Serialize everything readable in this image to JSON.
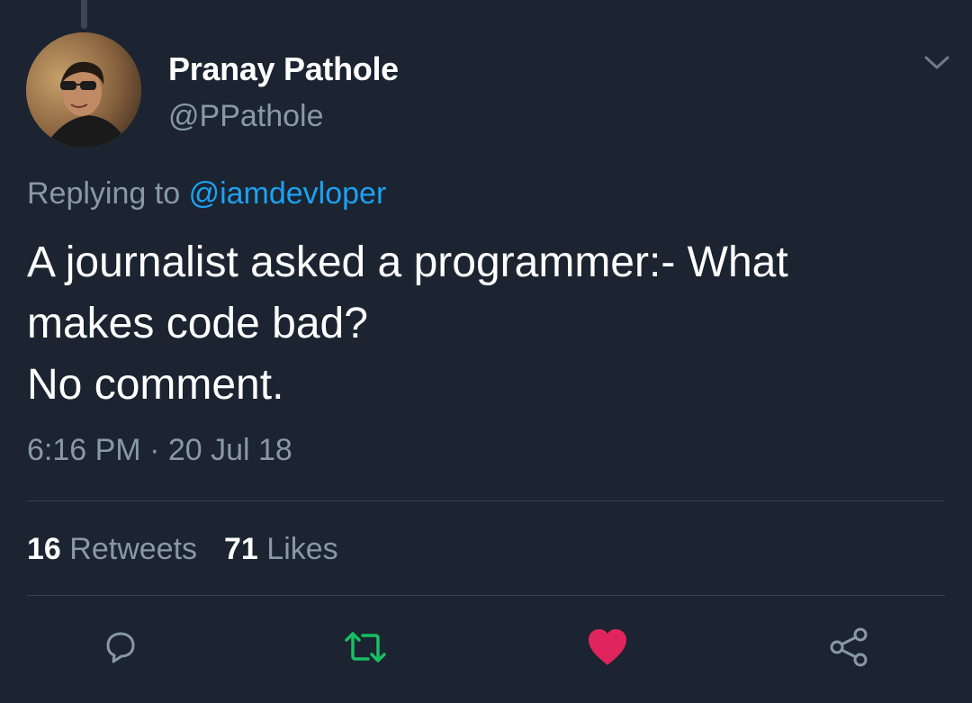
{
  "author": {
    "display_name": "Pranay Pathole",
    "handle": "@PPathole"
  },
  "reply": {
    "prefix": "Replying to",
    "mention": "@iamdevloper"
  },
  "text_lines": [
    "A journalist asked a programmer:- What",
    "makes code bad?",
    "No comment."
  ],
  "timestamp": "6:16 PM · 20 Jul 18",
  "stats": {
    "retweets_count": "16",
    "retweets_label": "Retweets",
    "likes_count": "71",
    "likes_label": "Likes"
  },
  "actions": {
    "reply_icon": "reply-icon",
    "retweet_icon": "retweet-icon",
    "like_icon": "heart-icon",
    "share_icon": "share-icon"
  },
  "colors": {
    "background": "#1b2430",
    "link": "#1da1f2",
    "muted": "#8899a6",
    "retweet": "#17bf63",
    "like": "#e0245e"
  }
}
